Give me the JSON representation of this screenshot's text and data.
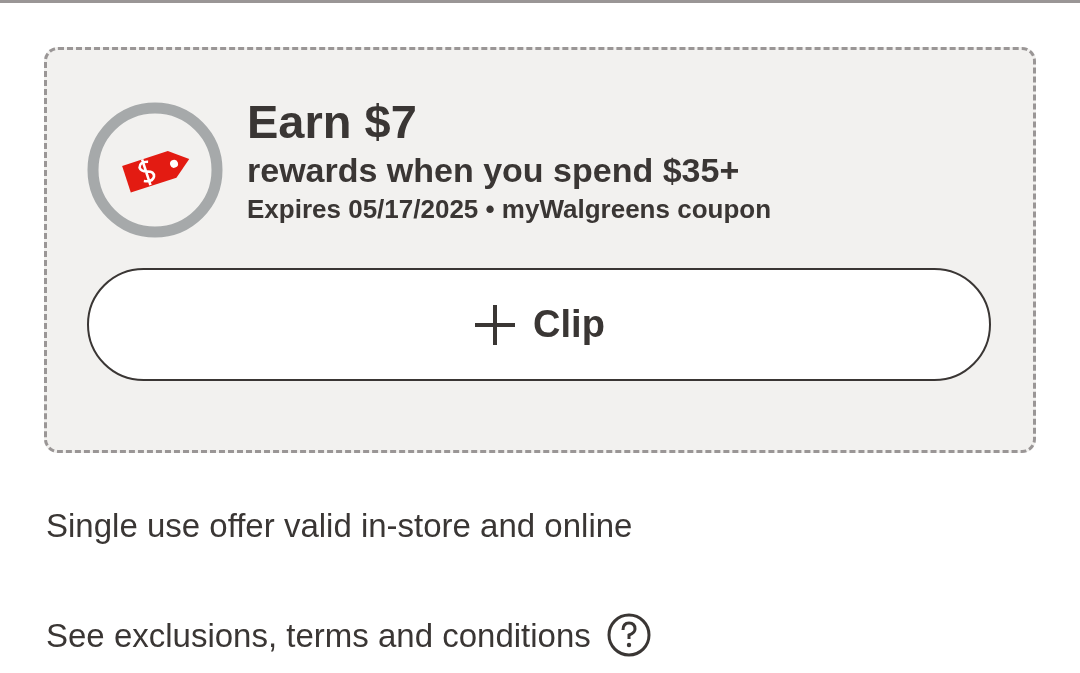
{
  "offer": {
    "title": "Earn $7",
    "subtitle": "rewards when you spend $35+",
    "meta": "Expires 05/17/2025 • myWalgreens coupon"
  },
  "clip_button": {
    "label": "Clip"
  },
  "details": [
    "Single use offer valid in-store and online"
  ],
  "terms_link": {
    "label": "See exclusions, terms and conditions"
  }
}
